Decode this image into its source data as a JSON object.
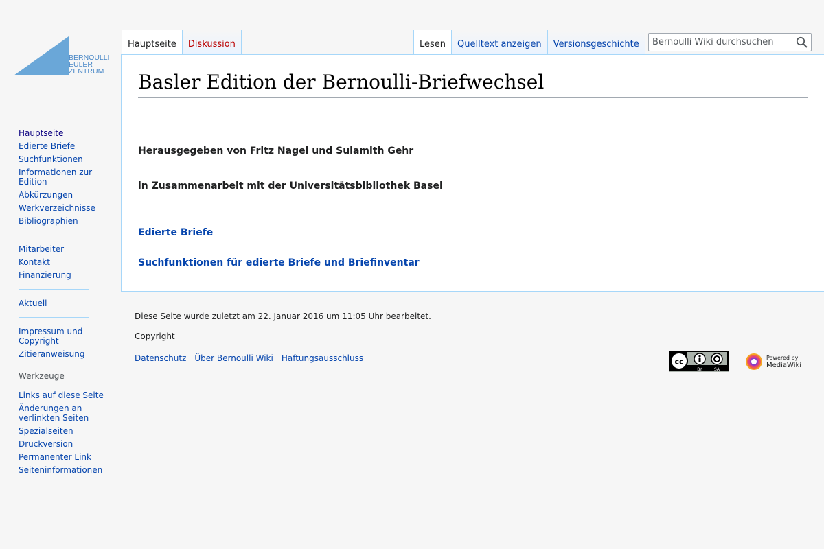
{
  "logo": {
    "line1": "BERNOULLI",
    "line2": "EULER",
    "line3": "ZENTRUM"
  },
  "tabs": {
    "left": [
      {
        "label": "Hauptseite",
        "state": "selected"
      },
      {
        "label": "Diskussion",
        "state": "new"
      }
    ],
    "right": [
      {
        "label": "Lesen",
        "state": "selected"
      },
      {
        "label": "Quelltext anzeigen"
      },
      {
        "label": "Versionsgeschichte"
      }
    ]
  },
  "search": {
    "placeholder": "Bernoulli Wiki durchsuchen",
    "value": "",
    "icon": "search-icon"
  },
  "sidebar": {
    "nav": [
      "Hauptseite",
      "Edierte Briefe",
      "Suchfunktionen",
      "Informationen zur Edition",
      "Abkürzungen",
      "Werkverzeichnisse",
      "Bibliographien"
    ],
    "group2": [
      "Mitarbeiter",
      "Kontakt",
      "Finanzierung"
    ],
    "group3": [
      "Aktuell"
    ],
    "group4": [
      "Impressum und Copyright",
      "Zitieranweisung"
    ],
    "tools_heading": "Werkzeuge",
    "tools": [
      "Links auf diese Seite",
      "Änderungen an verlinkten Seiten",
      "Spezialseiten",
      "Druckversion",
      "Permanenter Link",
      "Seiteninformationen"
    ]
  },
  "content": {
    "title": "Basler Edition der Bernoulli-Briefwechsel",
    "editors": "Herausgegeben von Fritz Nagel und Sulamith Gehr",
    "cooperation": "in Zusammenarbeit mit der Universitätsbibliothek Basel",
    "link1": "Edierte Briefe",
    "link2": "Suchfunktionen für edierte Briefe und Briefinventar"
  },
  "footer": {
    "lastmod": "Diese Seite wurde zuletzt am 22. Januar 2016 um 11:05 Uhr bearbeitet.",
    "copyright": "Copyright",
    "links": [
      "Datenschutz",
      "Über Bernoulli Wiki",
      "Haftungsausschluss"
    ],
    "cc_badge": {
      "top": "cc",
      "by": "BY",
      "sa": "SA"
    },
    "mw_badge": {
      "line1": "Powered by",
      "line2": "MediaWiki"
    }
  },
  "colors": {
    "link": "#0645ad",
    "visited": "#0b0080",
    "new": "#ba0000",
    "border": "#a7d7f9",
    "logo": "#5b9bd5"
  }
}
